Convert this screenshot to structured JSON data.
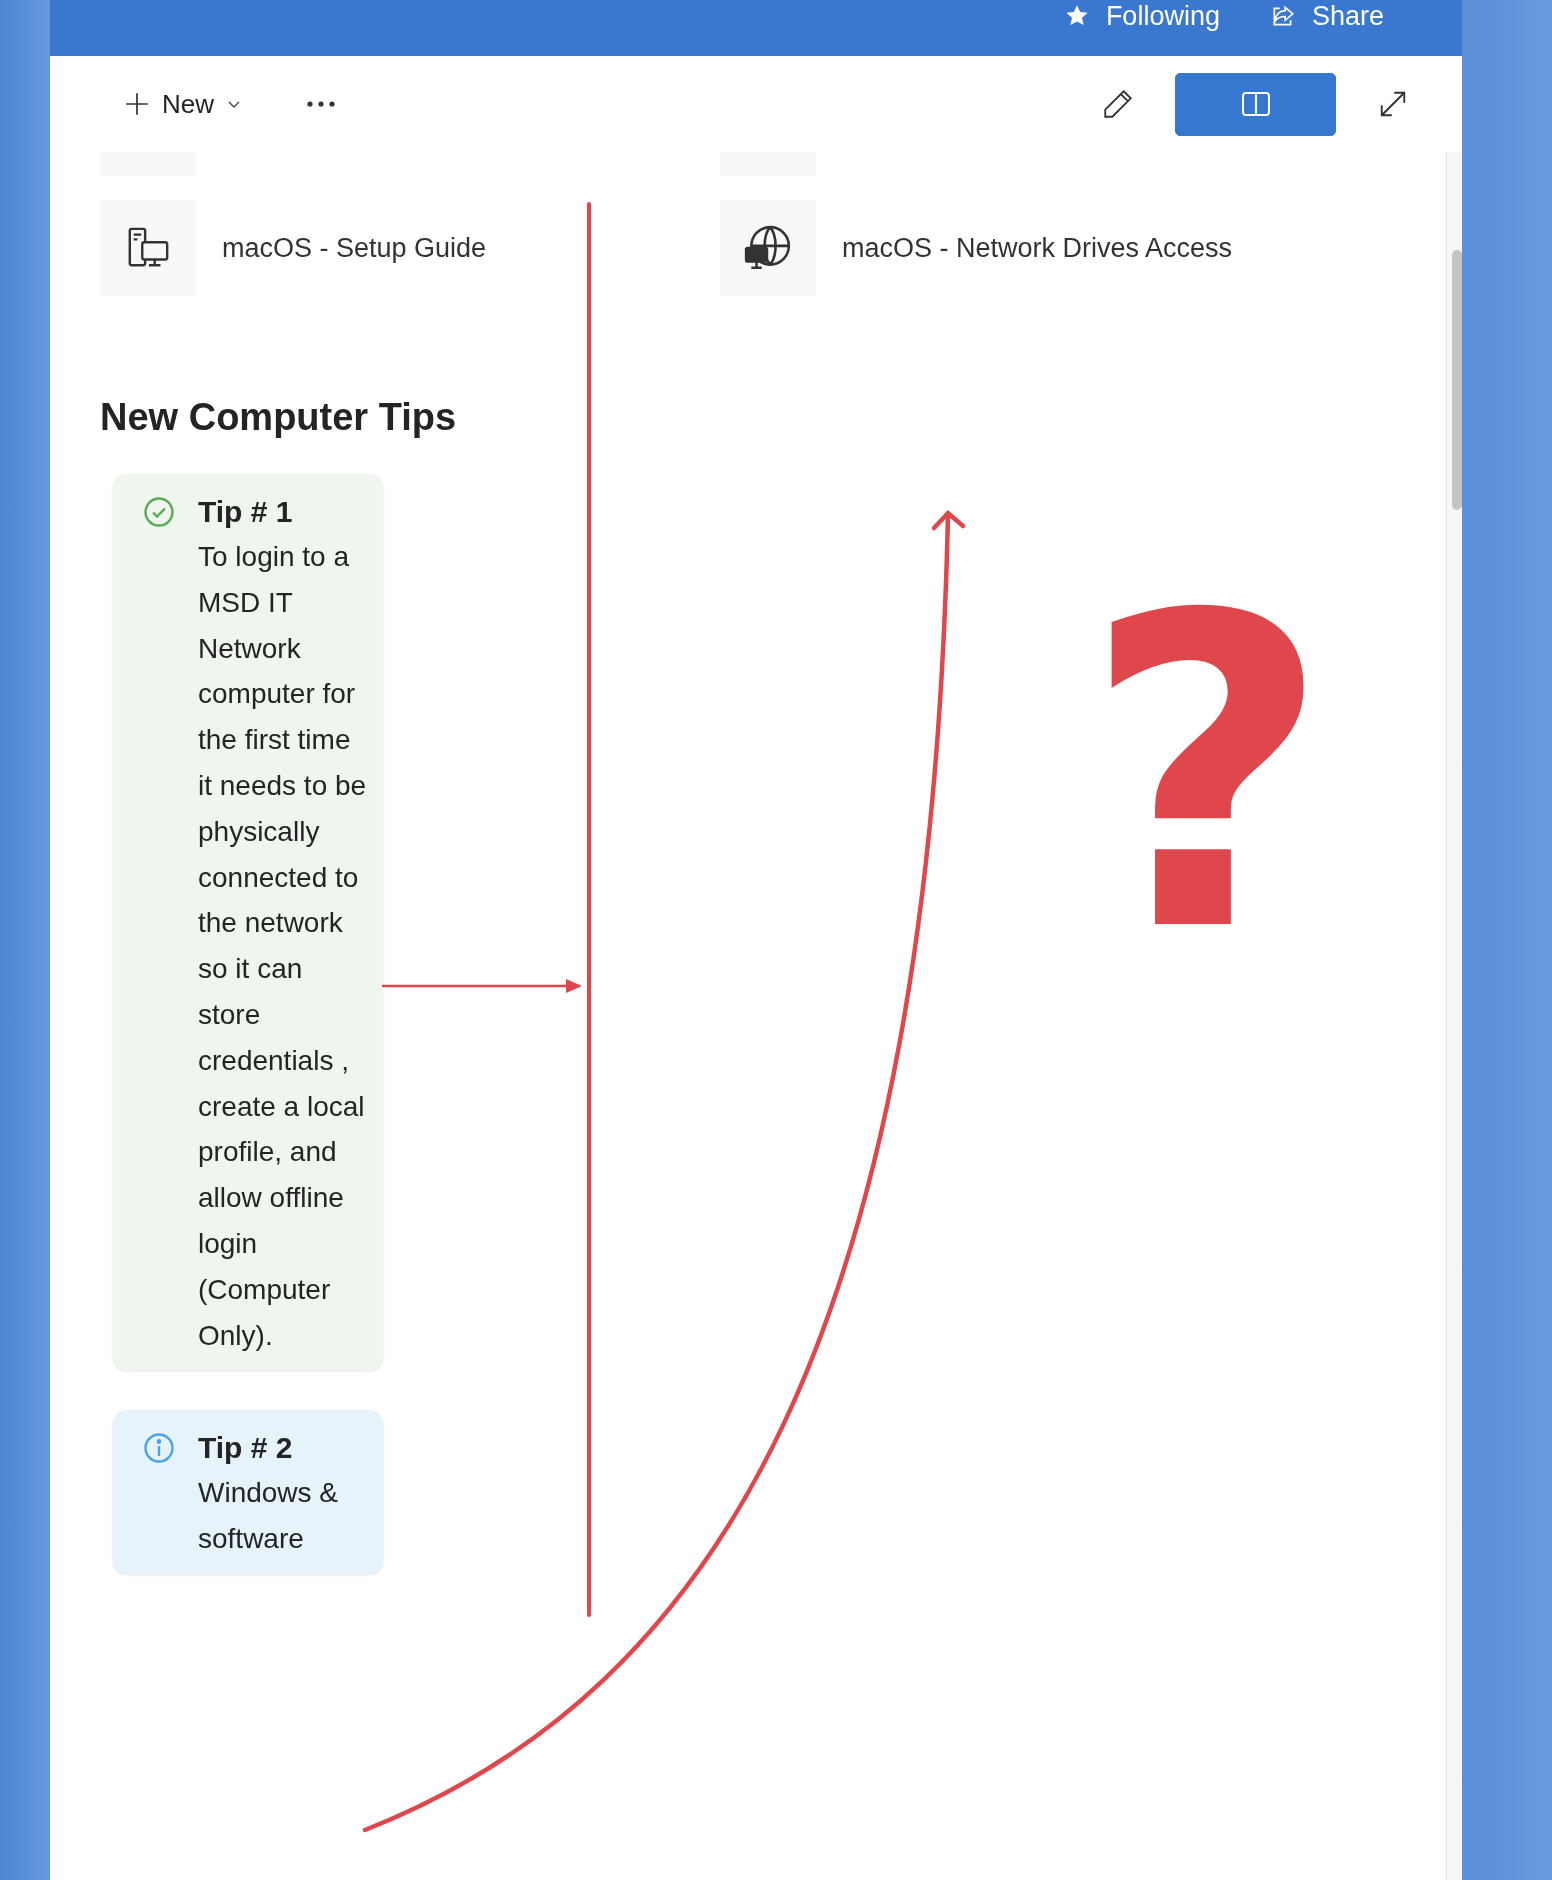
{
  "header": {
    "following": "Following",
    "share": "Share"
  },
  "toolbar": {
    "new": "New",
    "reading_view": {
      "selected": true
    }
  },
  "links": [
    {
      "kind": "devices",
      "label": "macOS - Setup Guide"
    },
    {
      "kind": "globe",
      "label": "macOS - Network Drives Access"
    }
  ],
  "section": {
    "title": "New Computer Tips"
  },
  "tips": [
    {
      "kind": "success",
      "title": "Tip # 1",
      "body": "To login to a MSD IT Network computer for the first time it needs to be physically connected to the network so it can store credentials , create a local profile, and allow offline login (Computer Only)."
    },
    {
      "kind": "info",
      "title": "Tip # 2",
      "body": "Windows & software"
    }
  ],
  "annotation": {
    "symbol": "?"
  }
}
